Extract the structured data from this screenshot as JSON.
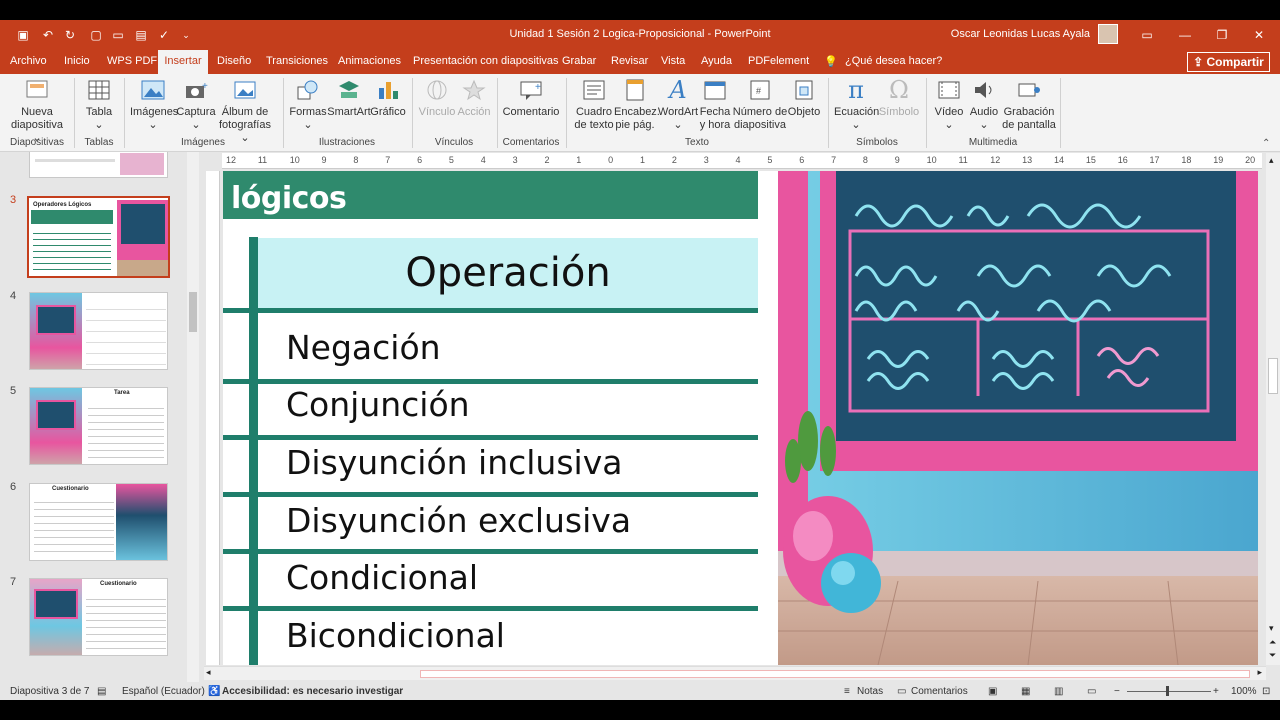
{
  "window": {
    "title": "Unidad 1 Sesión 2 Logica-Proposicional  -  PowerPoint",
    "user": "Oscar Leonidas Lucas Ayala"
  },
  "tabs": [
    "Archivo",
    "Inicio",
    "WPS PDF",
    "Insertar",
    "Diseño",
    "Transiciones",
    "Animaciones",
    "Presentación con diapositivas",
    "Grabar",
    "Revisar",
    "Vista",
    "Ayuda",
    "PDFelement"
  ],
  "tell_me": "¿Qué desea hacer?",
  "share": "Compartir",
  "ribbon": {
    "nueva": [
      "Nueva",
      "diapositiva ⌄"
    ],
    "tabla": [
      "Tabla",
      "⌄"
    ],
    "imagenes": [
      "Imágenes",
      "⌄"
    ],
    "captura": [
      "Captura",
      "⌄"
    ],
    "album": [
      "Álbum de",
      "fotografías ⌄"
    ],
    "formas": [
      "Formas",
      "⌄"
    ],
    "smartart": "SmartArt",
    "grafico": "Gráfico",
    "vinculo": "Vínculo",
    "accion": "Acción",
    "comentario": "Comentario",
    "cuadro": [
      "Cuadro",
      "de texto"
    ],
    "encabez": [
      "Encabez.",
      "pie pág."
    ],
    "wordart": [
      "WordArt",
      "⌄"
    ],
    "fecha": [
      "Fecha",
      "y hora"
    ],
    "numero": [
      "Número de",
      "diapositiva"
    ],
    "objeto": "Objeto",
    "ecuacion": [
      "Ecuación",
      "⌄"
    ],
    "simbolo": "Símbolo",
    "video": [
      "Vídeo",
      "⌄"
    ],
    "audio": [
      "Audio",
      "⌄"
    ],
    "grabacion": [
      "Grabación",
      "de pantalla"
    ],
    "groups": [
      "Diapositivas",
      "Tablas",
      "Imágenes",
      "Ilustraciones",
      "Vínculos",
      "Comentarios",
      "Texto",
      "Símbolos",
      "Multimedia"
    ]
  },
  "thumbnails": {
    "numbers": [
      "3",
      "4",
      "5",
      "6",
      "7"
    ],
    "thumb3_title": "Operadores Lógicos",
    "thumb5_title": "Tarea",
    "thumb6_title": "Cuestionario",
    "thumb7_title": "Cuestionario"
  },
  "ruler_top": [
    "12",
    "11",
    "10",
    "9",
    "8",
    "7",
    "6",
    "5",
    "4",
    "3",
    "2",
    "1",
    "0",
    "1",
    "2",
    "3",
    "4",
    "5",
    "6",
    "7",
    "8",
    "9",
    "10",
    "11",
    "12",
    "13",
    "14",
    "15",
    "16",
    "17",
    "18",
    "19",
    "20"
  ],
  "slide": {
    "heading": "lógicos",
    "table_header": "Operación",
    "operations": [
      "Negación",
      "Conjunción",
      "Disyunción inclusiva",
      "Disyunción exclusiva",
      "Condicional",
      "Bicondicional"
    ]
  },
  "status": {
    "slide": "Diapositiva 3 de 7",
    "language": "Español (Ecuador)",
    "accessibility": "Accesibilidad: es necesario investigar",
    "notes": "Notas",
    "comments": "Comentarios",
    "zoom": "100%"
  },
  "colors": {
    "accent": "#c43e1c",
    "table_green": "#1f7e6b",
    "header_fill": "#c8f2f4",
    "board_frame": "#e8559f",
    "board": "#1f4f6e"
  }
}
